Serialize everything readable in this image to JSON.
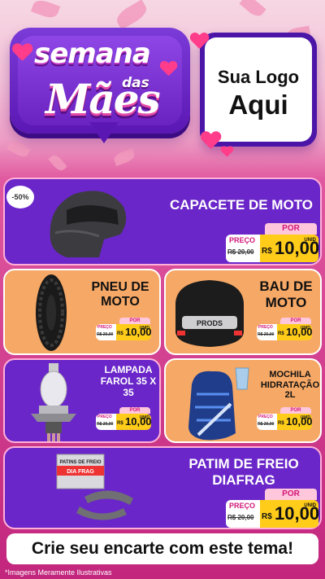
{
  "header": {
    "semana": "semana",
    "das": "das",
    "maes": "Mães",
    "logo_line1": "Sua Logo",
    "logo_line2": "Aqui"
  },
  "badge": "-50%",
  "products": [
    {
      "name": "CAPACETE DE MOTO",
      "image": "helmet-image",
      "por": "POR",
      "preco": "PREÇO",
      "old": "R$ 20,00",
      "currency": "R$",
      "value": "10,00",
      "unit": "UNID"
    },
    {
      "name": "PNEU DE MOTO",
      "image": "tire-image",
      "por": "POR",
      "preco": "PREÇO",
      "old": "R$ 20,00",
      "currency": "R$",
      "value": "10,00",
      "unit": "UNID"
    },
    {
      "name": "BAU DE MOTO",
      "image": "top-case-image",
      "por": "POR",
      "preco": "PREÇO",
      "old": "R$ 20,00",
      "currency": "R$",
      "value": "10,00",
      "unit": "UNID"
    },
    {
      "name": "LAMPADA FAROL 35 X 35",
      "image": "headlight-bulb-image",
      "por": "POR",
      "preco": "PREÇO",
      "old": "R$ 20,00",
      "currency": "R$",
      "value": "10,00",
      "unit": "UNID"
    },
    {
      "name": "MOCHILA HIDRATAÇÃO 2L",
      "image": "hydration-backpack-image",
      "por": "POR",
      "preco": "PREÇO",
      "old": "R$ 20,00",
      "currency": "R$",
      "value": "10,00",
      "unit": "UNID"
    },
    {
      "name": "PATIM DE FREIO DIAFRAG",
      "image": "brake-shoe-image",
      "por": "POR",
      "preco": "PREÇO",
      "old": "R$ 20,00",
      "currency": "R$",
      "value": "10,00",
      "unit": "UNID"
    }
  ],
  "product_text": {
    "bau_brand": "PRODS",
    "patim_box": "PATINS DE FREIO",
    "patim_brand": "DIA FRAG"
  },
  "footer": "Crie seu encarte com este tema!",
  "disclaimer": "*Imagens Meramente Ilustrativas",
  "colors": {
    "purple": "#6a26c9",
    "pink": "#e0589f",
    "yellow": "#ffcc1a",
    "orange": "#f6a866"
  }
}
